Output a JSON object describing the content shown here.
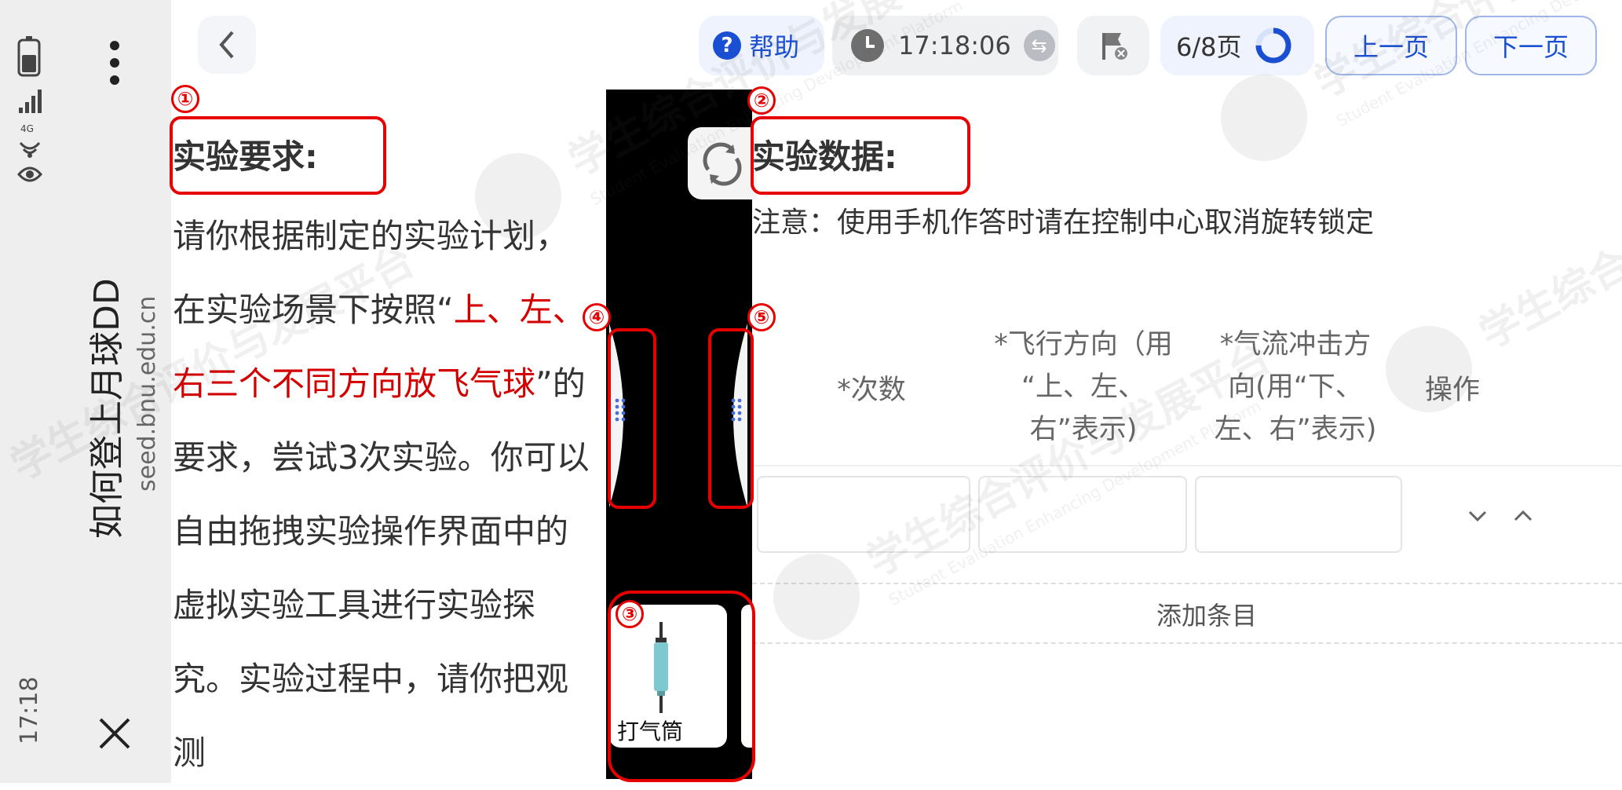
{
  "system_bar": {
    "app_title": "如何登上月球DD",
    "url": "seed.bnu.edu.cn",
    "time": "17:18",
    "network": "4G"
  },
  "toolbar": {
    "help_label": "帮助",
    "timer": "17:18:06",
    "page_indicator": "6/8页",
    "prev_label": "上一页",
    "next_label": "下一页"
  },
  "requirements": {
    "heading": "实验要求:",
    "text_before": "请你根据制定的实验计划，在实验场景下按照“",
    "text_highlight": "上、左、右三个不同方向放飞气球",
    "text_after": "”的要求，尝试3次实验。你可以自由拖拽实验操作界面中的虚拟实验工具进行实验探究。实验过程中，请你把观测"
  },
  "tools": {
    "pump_label": "打气筒"
  },
  "data_section": {
    "heading": "实验数据:",
    "note": "注意：使用手机作答时请在控制中心取消旋转锁定",
    "columns": {
      "count": "*次数",
      "flight_dir_1": "*飞行方向（用",
      "flight_dir_2": "“上、左、",
      "flight_dir_3": "右”表示)",
      "air_dir_1": "*气流冲击方",
      "air_dir_2": "向(用“下、",
      "air_dir_3": "左、右”表示)",
      "action": "操作"
    },
    "row_values": [
      "",
      "",
      ""
    ],
    "add_label": "添加条目"
  },
  "annotations": {
    "n1": "①",
    "n2": "②",
    "n3": "③",
    "n4": "④",
    "n5": "⑤"
  },
  "watermark": {
    "cn": "学生综合评价与发展平台",
    "en": "Student Evaluation Enhancing Development Platform"
  },
  "colors": {
    "accent": "#1a4fd3",
    "annotation_red": "#e60000",
    "highlight_red": "#d40000"
  }
}
